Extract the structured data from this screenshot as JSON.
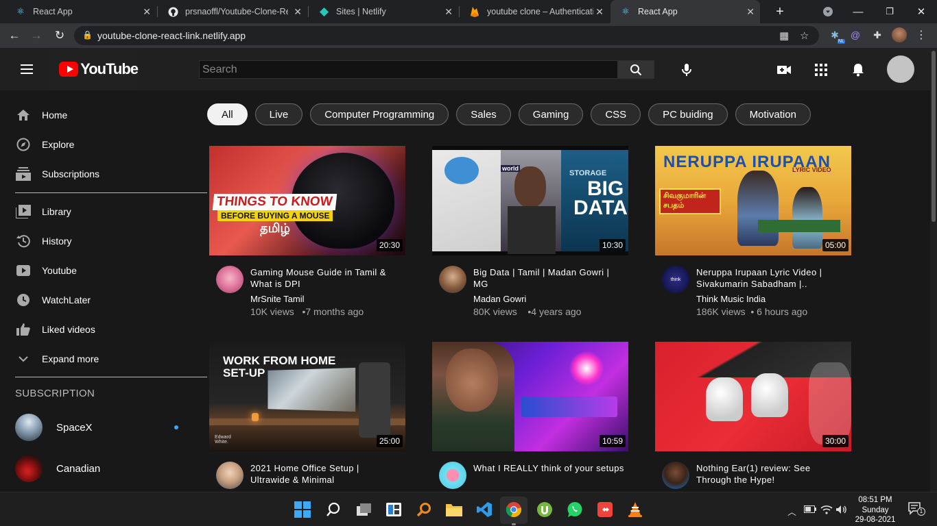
{
  "browser": {
    "tabs": [
      {
        "title": "React App",
        "active": false
      },
      {
        "title": "prsnaoffl/Youtube-Clone-Rea",
        "active": false
      },
      {
        "title": "Sites | Netlify",
        "active": false
      },
      {
        "title": "youtube clone – Authenticati",
        "active": false
      },
      {
        "title": "React App",
        "active": true
      }
    ],
    "url": "youtube-clone-react-link.netlify.app",
    "extension_badge": "NL"
  },
  "header": {
    "logo_text": "YouTube",
    "search_placeholder": "Search"
  },
  "sidebar": {
    "items": [
      {
        "label": "Home",
        "icon": "home-icon"
      },
      {
        "label": "Explore",
        "icon": "compass-icon"
      },
      {
        "label": "Subscriptions",
        "icon": "subscriptions-icon"
      },
      {
        "label": "Library",
        "icon": "library-icon"
      },
      {
        "label": "History",
        "icon": "history-icon"
      },
      {
        "label": "Youtube",
        "icon": "youtube-icon"
      },
      {
        "label": "WatchLater",
        "icon": "clock-icon"
      },
      {
        "label": "Liked videos",
        "icon": "thumbs-up-icon"
      },
      {
        "label": "Expand more",
        "icon": "chevron-down-icon"
      }
    ],
    "subscription_heading": "SUBSCRIPTION",
    "subscriptions": [
      {
        "name": "SpaceX",
        "new": true
      },
      {
        "name": "Canadian",
        "new": false
      }
    ]
  },
  "chips": [
    "All",
    "Live",
    "Computer Programming",
    "Sales",
    "Gaming",
    "CSS",
    "PC buiding",
    "Motivation"
  ],
  "videos": [
    {
      "title": "Gaming Mouse Guide in Tamil & What is DPI",
      "channel": "MrSnite Tamil",
      "views": "10K views",
      "age": "•7 months ago",
      "duration": "20:30",
      "thumb_text": [
        "THINGS TO KNOW",
        "BEFORE BUYING A MOUSE",
        "தமிழ்"
      ]
    },
    {
      "title": "Big Data | Tamil | Madan Gowri | MG",
      "channel": "Madan Gowri",
      "views": "80K views",
      "age": "•4 years ago",
      "duration": "10:30",
      "thumb_text": [
        "STORAGE",
        "BIG",
        "DATA",
        "world"
      ]
    },
    {
      "title": "Neruppa Irupaan Lyric Video | Sivakumarin Sabadham |..",
      "channel": "Think Music India",
      "views": "186K views",
      "age": "•  6 hours ago",
      "duration": "05:00",
      "thumb_text": [
        "NERUPPA IRUPAAN",
        "LYRIC VIDEO",
        "சிவகுமாரின் சபதம்"
      ]
    },
    {
      "title": "2021 Home Office Setup | Ultrawide & Minimal",
      "channel": "",
      "views": "",
      "age": "",
      "duration": "25:00",
      "thumb_text": [
        "WORK FROM HOME",
        "SET-UP",
        "Edward White."
      ]
    },
    {
      "title": "What I REALLY think of your setups",
      "channel": "",
      "views": "",
      "age": "",
      "duration": "10:59",
      "thumb_text": []
    },
    {
      "title": "Nothing Ear(1) review: See Through the Hype!",
      "channel": "",
      "views": "",
      "age": "",
      "duration": "30:00",
      "thumb_text": []
    }
  ],
  "taskbar": {
    "time": "08:51 PM",
    "day": "Sunday",
    "date": "29-08-2021",
    "notifications": "1"
  }
}
